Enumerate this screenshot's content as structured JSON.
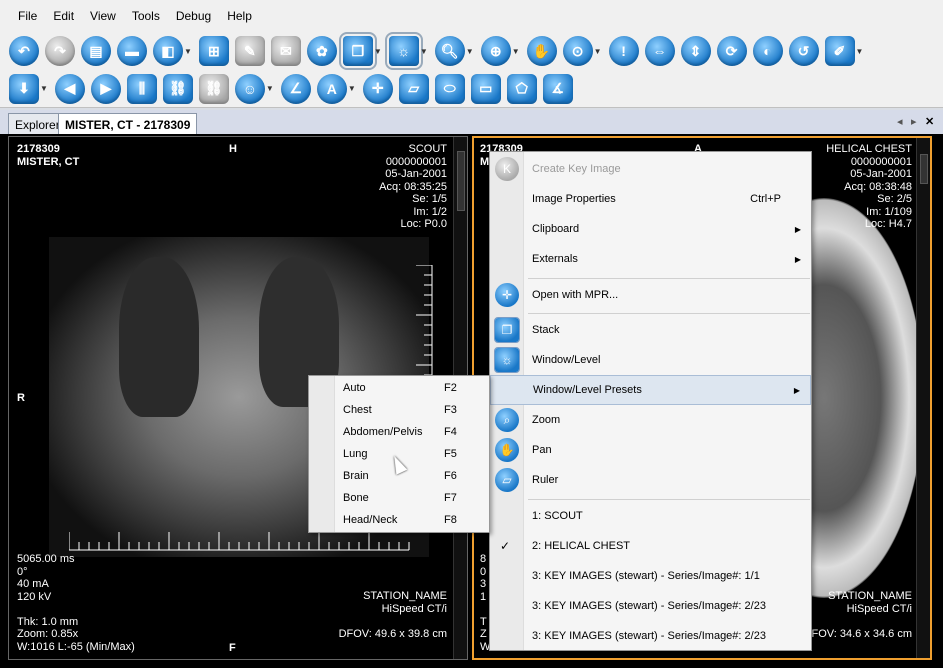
{
  "menu": [
    "File",
    "Edit",
    "View",
    "Tools",
    "Debug",
    "Help"
  ],
  "tabs": {
    "explorer": "Explorer",
    "study": "MISTER, CT - 2178309"
  },
  "left_viewport": {
    "top_left": [
      "2178309",
      "MISTER, CT"
    ],
    "top_center": "H",
    "top_right": [
      "SCOUT",
      "0000000001",
      "05-Jan-2001",
      "Acq: 08:35:25",
      "Se: 1/5",
      "Im: 1/2",
      "Loc: P0.0"
    ],
    "left_center": "R",
    "bottom_left": [
      "5065.00 ms",
      "0°",
      "40 mA",
      "120 kV",
      "",
      "Thk: 1.0 mm",
      "Zoom: 0.85x",
      "W:1016 L:-65 (Min/Max)"
    ],
    "bottom_right": [
      "STATION_NAME",
      "HiSpeed CT/i",
      "",
      "DFOV: 49.6 x 39.8 cm"
    ],
    "bottom_center": "F"
  },
  "right_viewport": {
    "top_left": [
      "2178309",
      "M"
    ],
    "top_center": "A",
    "top_right": [
      "HELICAL CHEST",
      "0000000001",
      "05-Jan-2001",
      "Acq: 08:38:48",
      "Se: 2/5",
      "Im: 1/109",
      "Loc: H4.7"
    ],
    "bottom_left": [
      "8",
      "0",
      "3",
      "1",
      "",
      "T",
      "Z",
      "W"
    ],
    "bottom_right": [
      "STATION_NAME",
      "HiSpeed CT/i",
      "",
      "DFOV: 34.6 x 34.6 cm"
    ]
  },
  "context_menu": {
    "items": [
      {
        "label": "Create Key Image",
        "icon": "key-image-icon",
        "disabled": true
      },
      {
        "label": "Image Properties",
        "shortcut": "Ctrl+P"
      },
      {
        "label": "Clipboard",
        "submenu": true
      },
      {
        "label": "Externals",
        "submenu": true
      },
      {
        "label": "Open with MPR...",
        "icon": "mpr-icon"
      },
      {
        "label": "Stack",
        "icon": "stack-icon"
      },
      {
        "label": "Window/Level",
        "icon": "window-level-icon"
      },
      {
        "label": "Window/Level Presets",
        "submenu": true
      },
      {
        "label": "Zoom",
        "icon": "zoom-icon"
      },
      {
        "label": "Pan",
        "icon": "pan-icon"
      },
      {
        "label": "Ruler",
        "icon": "ruler-icon"
      },
      {
        "label": "1: SCOUT"
      },
      {
        "label": "2: HELICAL CHEST",
        "checked": true
      },
      {
        "label": "3: KEY IMAGES (stewart) - Series/Image#: 1/1"
      },
      {
        "label": "3: KEY IMAGES (stewart) - Series/Image#: 2/23"
      },
      {
        "label": "3: KEY IMAGES (stewart) - Series/Image#: 2/23"
      }
    ],
    "check_mark": "✓",
    "arrow": "▶"
  },
  "presets_submenu": [
    {
      "label": "Auto",
      "shortcut": "F2"
    },
    {
      "label": "Chest",
      "shortcut": "F3"
    },
    {
      "label": "Abdomen/Pelvis",
      "shortcut": "F4"
    },
    {
      "label": "Lung",
      "shortcut": "F5"
    },
    {
      "label": "Brain",
      "shortcut": "F6"
    },
    {
      "label": "Bone",
      "shortcut": "F7"
    },
    {
      "label": "Head/Neck",
      "shortcut": "F8"
    }
  ]
}
